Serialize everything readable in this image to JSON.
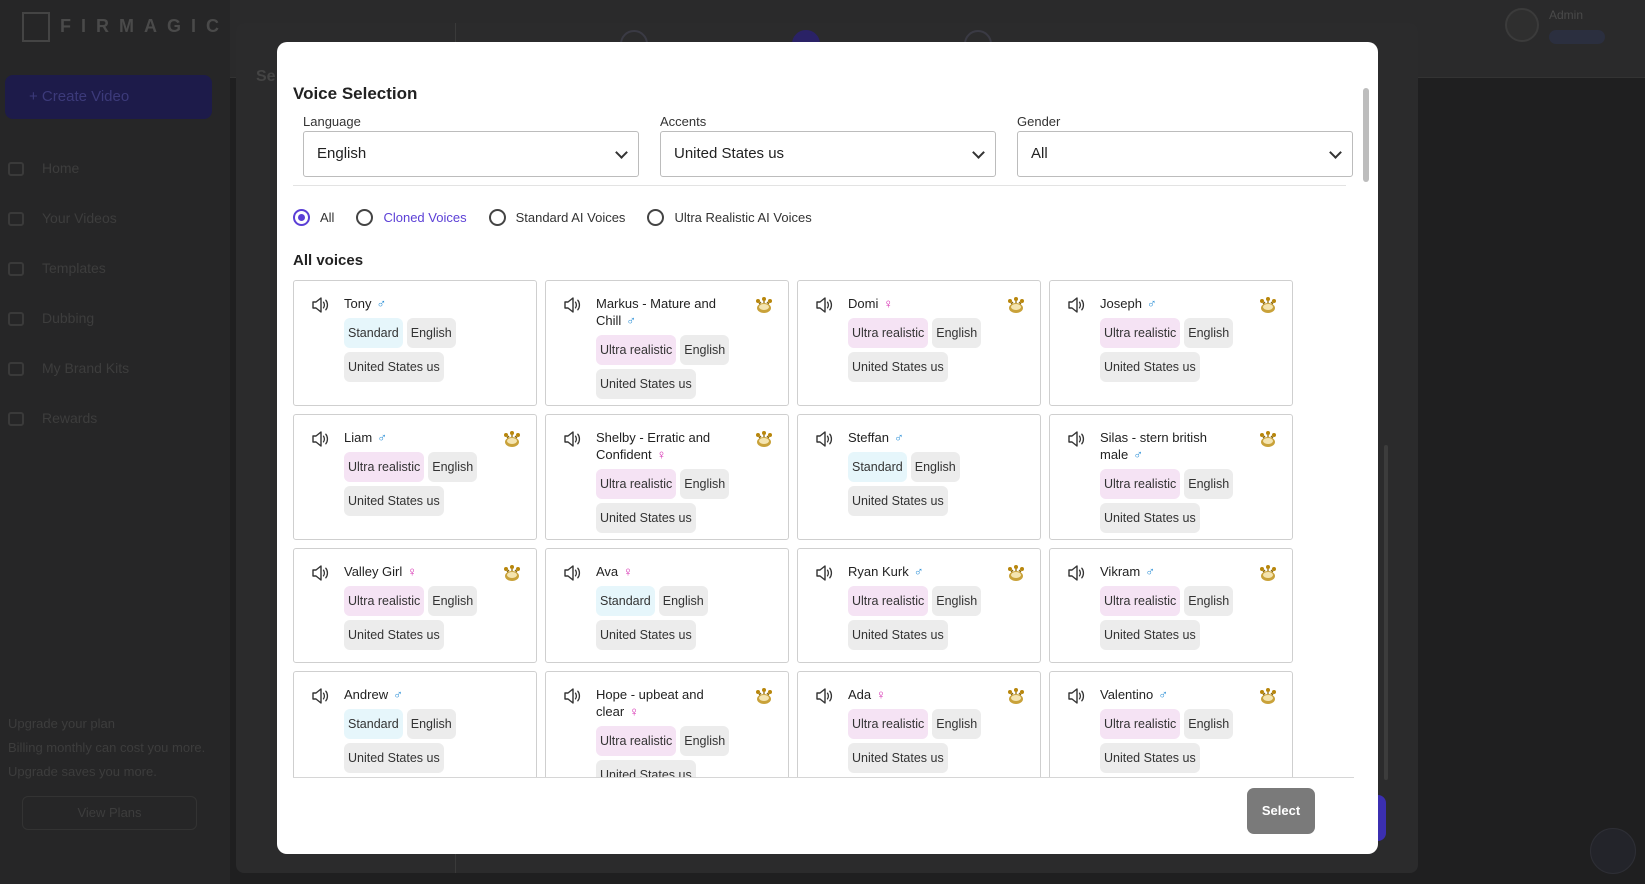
{
  "background": {
    "logo": "FIRMAGIC",
    "create_video": "+ Create Video",
    "nav": [
      "Home",
      "Your Videos",
      "Templates",
      "Dubbing",
      "My Brand Kits",
      "Rewards"
    ],
    "upgrade_title": "Upgrade your plan",
    "upgrade_text": "Billing monthly can cost you more. Upgrade saves you more.",
    "view_plans": "View Plans",
    "admin_name": "Admin",
    "wizard_heading": "Se"
  },
  "modal": {
    "title": "Voice Selection",
    "filters": {
      "language": {
        "label": "Language",
        "value": "English"
      },
      "accents": {
        "label": "Accents",
        "value": "United States us"
      },
      "gender": {
        "label": "Gender",
        "value": "All"
      }
    },
    "voice_types": [
      {
        "label": "All",
        "selected": true
      },
      {
        "label": "Cloned Voices",
        "selected": false
      },
      {
        "label": "Standard AI Voices",
        "selected": false
      },
      {
        "label": "Ultra Realistic AI Voices",
        "selected": false
      }
    ],
    "section_title": "All voices",
    "select_button": "Select",
    "gender_symbols": {
      "male": "♂",
      "female": "♀"
    },
    "colors": {
      "accent": "#5b3fd6",
      "male": "#2b8fd6",
      "female": "#d62bb0",
      "premium": "#b8860b"
    }
  },
  "voices": [
    {
      "name": "Tony",
      "gender": "male",
      "premium": false,
      "tags": [
        "Standard",
        "English",
        "United States us"
      ]
    },
    {
      "name": "Markus - Mature and Chill",
      "gender": "male",
      "premium": true,
      "tags": [
        "Ultra realistic",
        "English",
        "United States us"
      ]
    },
    {
      "name": "Domi",
      "gender": "female",
      "premium": true,
      "tags": [
        "Ultra realistic",
        "English",
        "United States us"
      ]
    },
    {
      "name": "Joseph",
      "gender": "male",
      "premium": true,
      "tags": [
        "Ultra realistic",
        "English",
        "United States us"
      ]
    },
    {
      "name": "Liam",
      "gender": "male",
      "premium": true,
      "tags": [
        "Ultra realistic",
        "English",
        "United States us"
      ]
    },
    {
      "name": "Shelby - Erratic and Confident",
      "gender": "female",
      "premium": true,
      "tags": [
        "Ultra realistic",
        "English",
        "United States us"
      ]
    },
    {
      "name": "Steffan",
      "gender": "male",
      "premium": false,
      "tags": [
        "Standard",
        "English",
        "United States us"
      ]
    },
    {
      "name": "Silas - stern british male",
      "gender": "male",
      "premium": true,
      "tags": [
        "Ultra realistic",
        "English",
        "United States us"
      ]
    },
    {
      "name": "Valley Girl",
      "gender": "female",
      "premium": true,
      "tags": [
        "Ultra realistic",
        "English",
        "United States us"
      ]
    },
    {
      "name": "Ava",
      "gender": "female",
      "premium": false,
      "tags": [
        "Standard",
        "English",
        "United States us"
      ]
    },
    {
      "name": "Ryan Kurk",
      "gender": "male",
      "premium": true,
      "tags": [
        "Ultra realistic",
        "English",
        "United States us"
      ]
    },
    {
      "name": "Vikram",
      "gender": "male",
      "premium": true,
      "tags": [
        "Ultra realistic",
        "English",
        "United States us"
      ]
    },
    {
      "name": "Andrew",
      "gender": "male",
      "premium": false,
      "tags": [
        "Standard",
        "English",
        "United States us"
      ]
    },
    {
      "name": "Hope - upbeat and clear",
      "gender": "female",
      "premium": true,
      "tags": [
        "Ultra realistic",
        "English",
        "United States us"
      ]
    },
    {
      "name": "Ada",
      "gender": "female",
      "premium": true,
      "tags": [
        "Ultra realistic",
        "English",
        "United States us"
      ]
    },
    {
      "name": "Valentino",
      "gender": "male",
      "premium": true,
      "tags": [
        "Ultra realistic",
        "English",
        "United States us"
      ]
    }
  ]
}
